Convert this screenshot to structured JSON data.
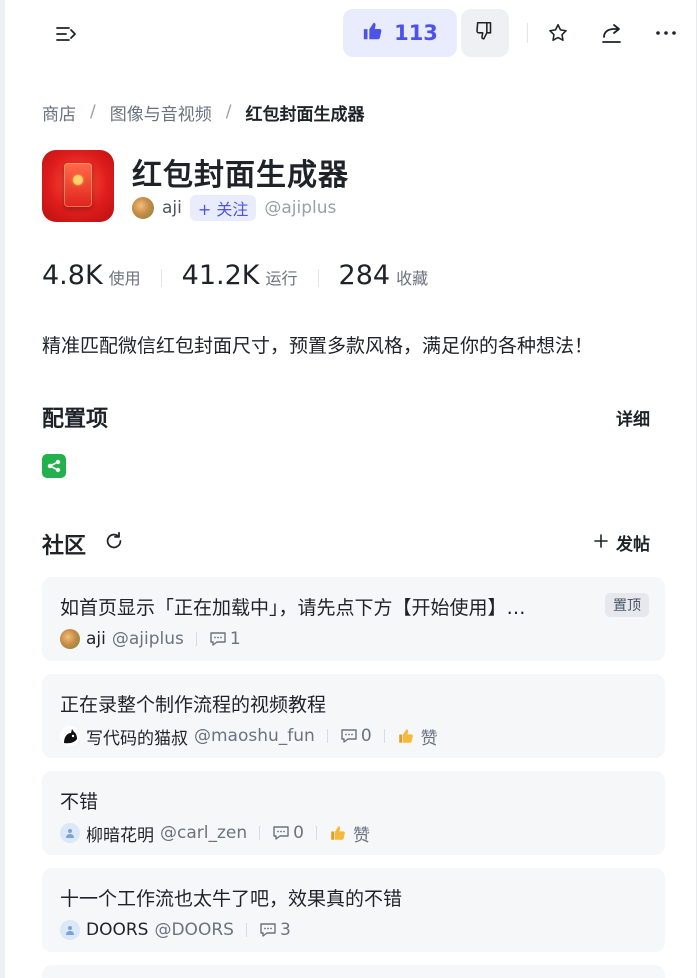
{
  "toolbar": {
    "like_count": "113",
    "menu_icon": "sidebar-expand-icon",
    "like_icon": "thumbs-up-icon",
    "dislike_icon": "thumbs-down-icon",
    "favorite_icon": "star-icon",
    "share_icon": "share-icon",
    "more_icon": "more-icon",
    "accent": "#4d53e8"
  },
  "breadcrumb": {
    "items": [
      "商店",
      "图像与音视频"
    ],
    "separator": "/",
    "current": "红包封面生成器"
  },
  "app": {
    "title": "红包封面生成器",
    "author_name": "aji",
    "follow_label": "+ 关注",
    "author_handle": "@ajiplus",
    "description": "精准匹配微信红包封面尺寸，预置多款风格，满足你的各种想法！"
  },
  "stats": [
    {
      "value": "4.8K",
      "label": "使用"
    },
    {
      "value": "41.2K",
      "label": "运行"
    },
    {
      "value": "284",
      "label": "收藏"
    }
  ],
  "config": {
    "title": "配置项",
    "detail_label": "详细",
    "workflow_icon": "workflow-icon",
    "workflow_color": "#22b14c"
  },
  "community": {
    "title": "社区",
    "post_label": "发帖",
    "posts": [
      {
        "title": "如首页显示「正在加载中」，请先点下方【开始使用】…",
        "badge": "置顶",
        "author": "aji",
        "handle": "@ajiplus",
        "comments": "1"
      },
      {
        "title": "正在录整个制作流程的视频教程",
        "author": "写代码的猫叔",
        "handle": "@maoshu_fun",
        "comments": "0",
        "like_label": "赞"
      },
      {
        "title": "不错",
        "author": "柳暗花明",
        "handle": "@carl_zen",
        "comments": "0",
        "like_label": "赞"
      },
      {
        "title": "十一个工作流也太牛了吧，效果真的不错",
        "author": "DOORS",
        "handle": "@DOORS",
        "comments": "3"
      }
    ]
  }
}
